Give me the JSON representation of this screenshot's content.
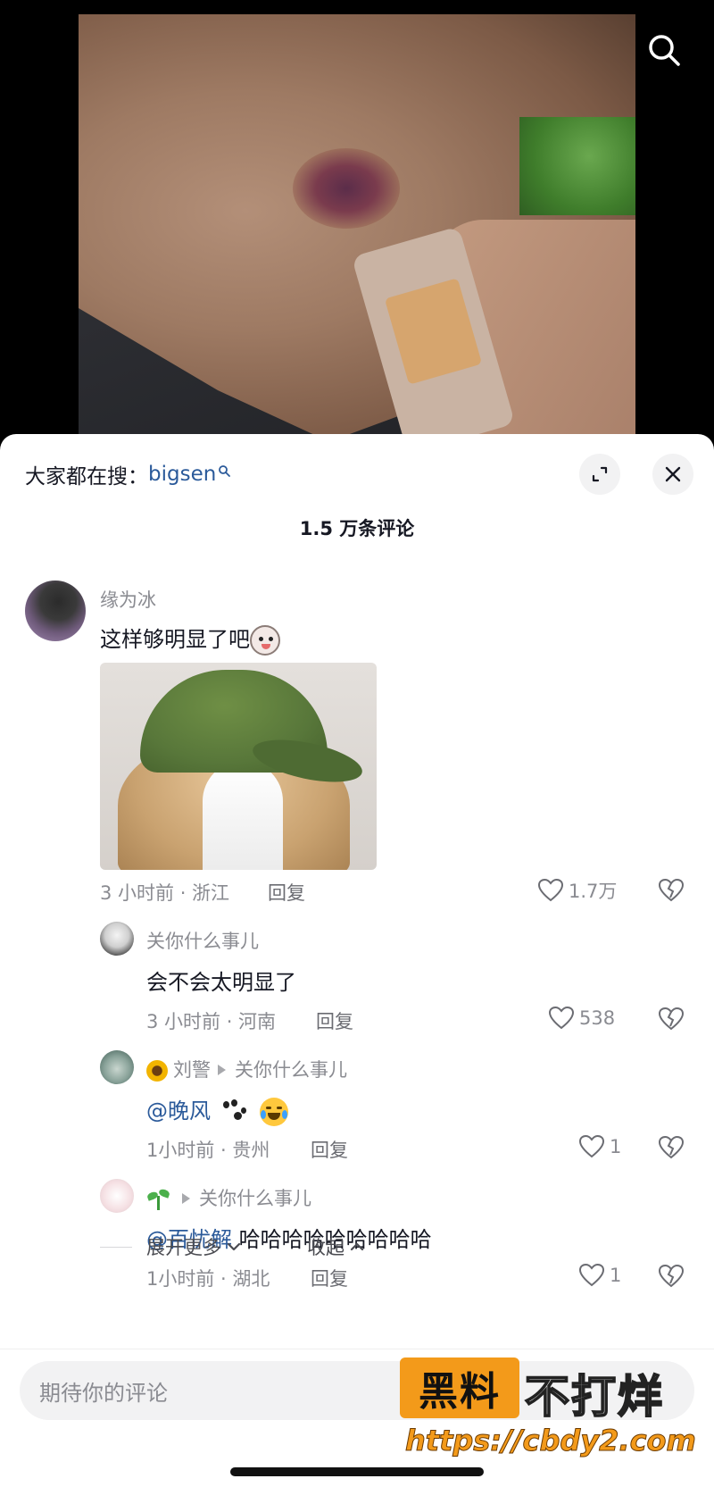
{
  "hot_search": {
    "prefix": "大家都在搜：",
    "term": "bigsen"
  },
  "comment_count_title": "1.5 万条评论",
  "comments": [
    {
      "user": "缘为冰",
      "text": "这样够明显了吧",
      "meta": "3 小时前 · 浙江",
      "reply_label": "回复",
      "likes": "1.7万"
    },
    {
      "user": "关你什么事儿",
      "text": "会不会太明显了",
      "meta": "3 小时前 · 河南",
      "reply_label": "回复",
      "likes": "538"
    },
    {
      "user": "刘警",
      "reply_to": "关你什么事儿",
      "mention": "@晚风",
      "text": "",
      "meta": "1小时前 · 贵州",
      "reply_label": "回复",
      "likes": "1"
    },
    {
      "user": "",
      "reply_to": "关你什么事儿",
      "mention": "@百忧解",
      "text": " 哈哈哈哈哈哈哈哈哈",
      "meta": "1小时前 · 湖北",
      "reply_label": "回复",
      "likes": "1"
    }
  ],
  "expand_more": "展开更多",
  "collapse": "收起",
  "input_placeholder": "期待你的评论",
  "watermark": {
    "badge": "黑料",
    "slogan": "不打烊",
    "url": "https://cbdy2.com"
  },
  "colors": {
    "mention": "#2b5a9a",
    "watermark_orange": "#f39a1a",
    "muted_text": "#8a8b91"
  },
  "icons": [
    "search-icon",
    "expand-icon",
    "close-icon",
    "heart-icon",
    "dislike-icon",
    "chevron-down-icon",
    "chevron-up-icon",
    "sunflower-emoji",
    "sprout-emoji",
    "paw-emoji",
    "crying-laughing-emoji",
    "dog-emoji"
  ]
}
